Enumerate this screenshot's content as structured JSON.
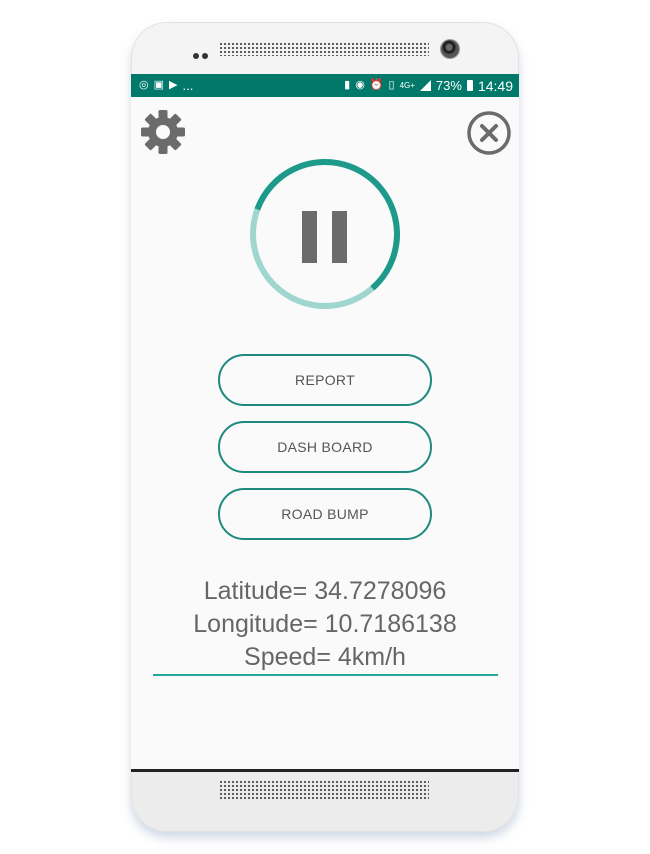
{
  "statusbar": {
    "left_icons": [
      "whatsapp-icon",
      "instagram-icon",
      "youtube-icon"
    ],
    "overflow": "...",
    "network": "4G+",
    "battery": "73%",
    "time": "14:49"
  },
  "toolbar": {
    "settings_icon": "gear-icon",
    "close_icon": "close-circle-icon"
  },
  "tracker": {
    "state_icon": "pause-icon",
    "progress": 0.58
  },
  "buttons": {
    "report": "REPORT",
    "dashboard": "DASH BOARD",
    "road_bump": "ROAD BUMP"
  },
  "info": {
    "latitude": "Latitude= 34.7278096",
    "longitude": "Longitude= 10.7186138",
    "speed": "Speed= 4km/h"
  },
  "colors": {
    "accent": "#00796b",
    "ring_dark": "#1e9a8a",
    "ring_light": "#9fd6d0",
    "icon_gray": "#6b6b6b"
  }
}
